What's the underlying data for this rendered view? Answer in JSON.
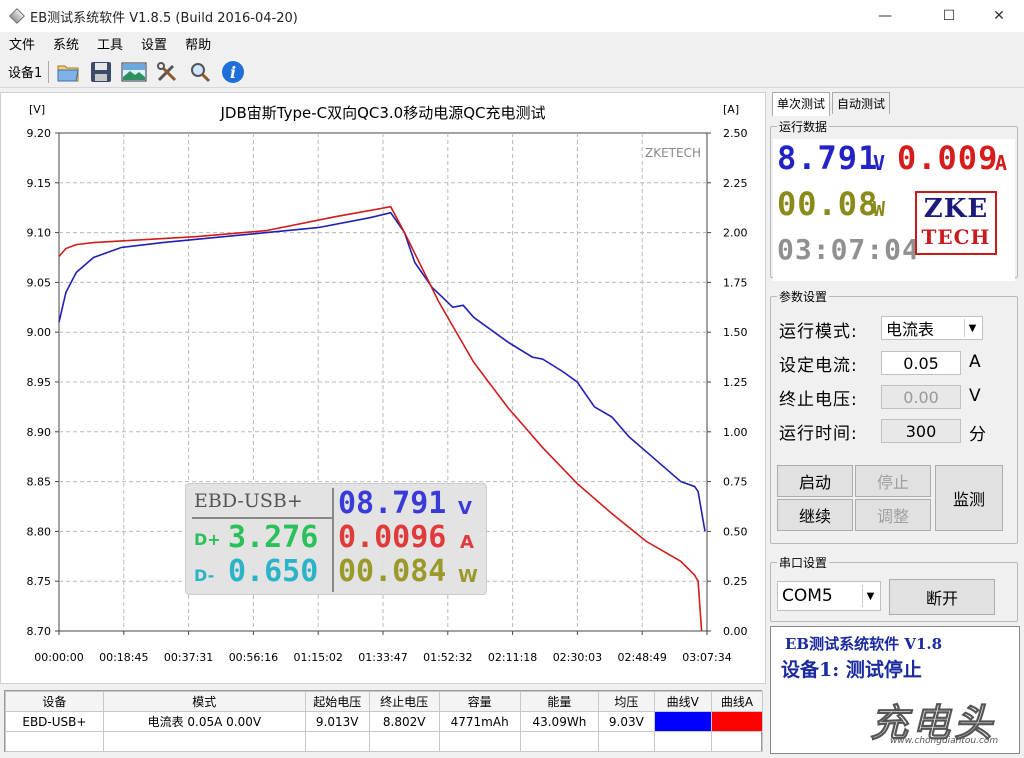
{
  "window": {
    "title": "EB测试系统软件 V1.8.5 (Build 2016-04-20)"
  },
  "menu": [
    "文件",
    "系统",
    "工具",
    "设置",
    "帮助"
  ],
  "toolbar": {
    "device_label": "设备1",
    "icons": [
      "open-folder-icon",
      "save-icon",
      "picture-icon",
      "tools-icon",
      "zoom-icon",
      "info-icon"
    ]
  },
  "chart_data": {
    "type": "line",
    "title": "JDB宙斯Type-C双向QC3.0移动电源QC充电测试",
    "watermark": "ZKETECH",
    "ylabel_left": "[V]",
    "ylabel_right": "[A]",
    "ylim_left": [
      8.7,
      9.2
    ],
    "ylim_right": [
      0.0,
      2.5
    ],
    "yticks_left": [
      "9.20",
      "9.15",
      "9.10",
      "9.05",
      "9.00",
      "8.95",
      "8.90",
      "8.85",
      "8.80",
      "8.75",
      "8.70"
    ],
    "yticks_right": [
      "2.50",
      "2.25",
      "2.00",
      "1.75",
      "1.50",
      "1.25",
      "1.00",
      "0.75",
      "0.50",
      "0.25",
      "0.00"
    ],
    "xticks": [
      "00:00:00",
      "00:18:45",
      "00:37:31",
      "00:56:16",
      "01:15:02",
      "01:33:47",
      "01:52:32",
      "02:11:18",
      "02:30:03",
      "02:48:49",
      "03:07:34"
    ],
    "x_unit": "minutes",
    "grid": true,
    "series": [
      {
        "color": "#1f1fb4",
        "axis": "left",
        "x": [
          0,
          2,
          5,
          10,
          18,
          30,
          45,
          60,
          75,
          90,
          96,
          100,
          103,
          108,
          111,
          114,
          117,
          120,
          130,
          137,
          140,
          146,
          150,
          155,
          160,
          165,
          170,
          175,
          180,
          184,
          185,
          187
        ],
        "y": [
          9.01,
          9.04,
          9.06,
          9.075,
          9.085,
          9.09,
          9.095,
          9.1,
          9.105,
          9.115,
          9.12,
          9.1,
          9.07,
          9.045,
          9.035,
          9.025,
          9.027,
          9.015,
          8.99,
          8.975,
          8.973,
          8.96,
          8.95,
          8.925,
          8.915,
          8.895,
          8.88,
          8.865,
          8.85,
          8.845,
          8.84,
          8.8
        ]
      },
      {
        "color": "#d01c1c",
        "axis": "right",
        "x": [
          0,
          2,
          5,
          10,
          20,
          40,
          60,
          80,
          96,
          100,
          110,
          120,
          130,
          140,
          150,
          160,
          170,
          180,
          184,
          185,
          186
        ],
        "y": [
          1.88,
          1.92,
          1.94,
          1.95,
          1.96,
          1.98,
          2.01,
          2.08,
          2.13,
          2.0,
          1.65,
          1.35,
          1.12,
          0.92,
          0.74,
          0.59,
          0.45,
          0.35,
          0.28,
          0.25,
          0.0
        ]
      }
    ]
  },
  "overlay_panel": {
    "title": "EBD-USB+",
    "voltage": "08.791",
    "voltage_unit": "V",
    "dplus_label": "D+",
    "dplus": "3.276",
    "current": "0.0096",
    "current_unit": "A",
    "dminus_label": "D-",
    "dminus": "0.650",
    "power": "00.084",
    "power_unit": "W"
  },
  "table": {
    "headers": [
      "设备",
      "模式",
      "起始电压",
      "终止电压",
      "容量",
      "能量",
      "均压",
      "曲线V",
      "曲线A"
    ],
    "rows": [
      [
        "EBD-USB+",
        "电流表  0.05A  0.00V",
        "9.013V",
        "8.802V",
        "4771mAh",
        "43.09Wh",
        "9.03V",
        "",
        ""
      ]
    ],
    "curve_colors": [
      "#0000ff",
      "#ff0000"
    ]
  },
  "right_panel": {
    "tabs": [
      "单次测试",
      "自动测试"
    ],
    "run_data": {
      "legend": "运行数据",
      "voltage": "8.791",
      "voltage_unit": "V",
      "current": "0.009",
      "current_unit": "A",
      "power": "00.08",
      "power_unit": "W",
      "time": "03:07:04",
      "logo_line1": "ZKE",
      "logo_line2": "TECH"
    },
    "params": {
      "legend": "参数设置",
      "mode_label": "运行模式:",
      "mode_value": "电流表",
      "current_label": "设定电流:",
      "current_value": "0.05",
      "current_unit": "A",
      "stopv_label": "终止电压:",
      "stopv_value": "0.00",
      "stopv_unit": "V",
      "time_label": "运行时间:",
      "time_value": "300",
      "time_unit": "分",
      "buttons": {
        "start": "启动",
        "stop": "停止",
        "continue": "继续",
        "adjust": "调整",
        "monitor": "监测"
      }
    },
    "serial": {
      "legend": "串口设置",
      "port": "COM5",
      "disconnect": "断开"
    },
    "status": {
      "line1": "EB测试系统软件 V1.8",
      "line2": "设备1: 测试停止"
    }
  },
  "watermark": {
    "text": "充电头",
    "url": "www.chongdiantou.com"
  }
}
